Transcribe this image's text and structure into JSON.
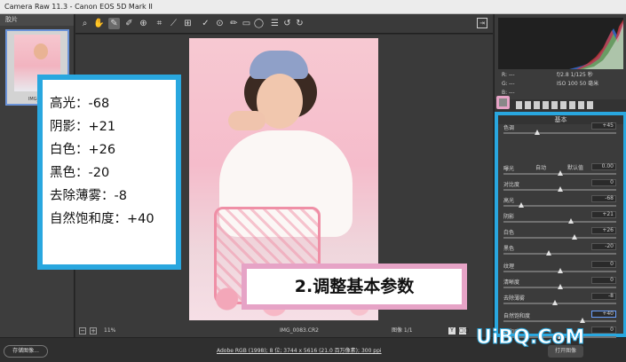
{
  "titlebar": {
    "title": "Camera Raw 11.3 - Canon EOS 5D Mark II"
  },
  "filmstrip": {
    "header": "胶片",
    "caption": "IMG_0..."
  },
  "annotation": {
    "lines": [
      "高光：-68",
      "阴影：+21",
      "白色：+26",
      "黑色：-20",
      "去除薄雾：-8",
      "自然饱和度：+40"
    ]
  },
  "callout": {
    "text": "2.调整基本参数"
  },
  "statusbar": {
    "zoom": "11%",
    "filename": "IMG_0083.CR2",
    "nav": "图像 1/1",
    "view_y": "Y",
    "view_compare": "▢▢"
  },
  "bottombar": {
    "save_label": "存储图像...",
    "meta": "Adobe RGB (1998); 8 位; 3744 x 5616 (21.0 百万像素); 300 ppi",
    "open_label": "打开图像"
  },
  "exif": {
    "r_label": "R:",
    "g_label": "G:",
    "b_label": "B:",
    "dash": "---",
    "aperture_shutter": "f/2.8  1/125 秒",
    "iso_focal": "ISO 100  50 毫米"
  },
  "panel": {
    "section_title": "基本",
    "auto": "自动",
    "default": "默认值",
    "rows": [
      {
        "label": "色调",
        "value": "+45",
        "pos": 0.3
      },
      {
        "label": "曝光",
        "value": "0.00",
        "pos": 0.5
      },
      {
        "label": "对比度",
        "value": "0",
        "pos": 0.5
      },
      {
        "label": "高光",
        "value": "-68",
        "pos": 0.16
      },
      {
        "label": "阴影",
        "value": "+21",
        "pos": 0.6
      },
      {
        "label": "白色",
        "value": "+26",
        "pos": 0.63
      },
      {
        "label": "黑色",
        "value": "-20",
        "pos": 0.4
      },
      {
        "label": "纹理",
        "value": "0",
        "pos": 0.5
      },
      {
        "label": "清晰度",
        "value": "0",
        "pos": 0.5
      },
      {
        "label": "去除薄雾",
        "value": "-8",
        "pos": 0.46
      },
      {
        "label": "自然饱和度",
        "value": "+40",
        "pos": 0.7
      },
      {
        "label": "饱和度",
        "value": "0",
        "pos": 0.5
      }
    ]
  },
  "watermark": {
    "text": "UiBQ.CoM"
  },
  "colors": {
    "accent_blue": "#29a7df",
    "accent_pink": "#e6a3c6"
  }
}
